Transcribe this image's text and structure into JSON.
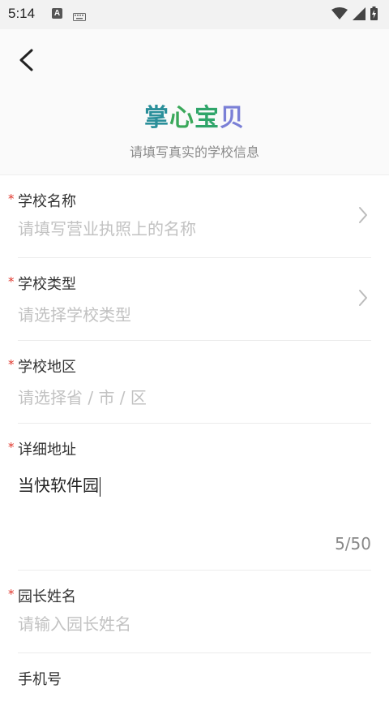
{
  "status_bar": {
    "time": "5:14",
    "notif_letter": "A"
  },
  "header": {
    "title_chars": [
      "掌",
      "心",
      "宝",
      "贝"
    ],
    "subtitle": "请填写真实的学校信息"
  },
  "colors": {
    "title_1": "#2a8f9a",
    "title_2": "#3aa85a",
    "title_3": "#2fa56a",
    "title_4": "#7a7fd6",
    "required": "#e0352b"
  },
  "form": {
    "school_name": {
      "label": "学校名称",
      "placeholder": "请填写营业执照上的名称"
    },
    "school_type": {
      "label": "学校类型",
      "placeholder": "请选择学校类型"
    },
    "school_region": {
      "label": "学校地区",
      "placeholder": "请选择省 / 市 / 区"
    },
    "address": {
      "label": "详细地址",
      "value": "当快软件园",
      "counter": "5/50"
    },
    "principal": {
      "label": "园长姓名",
      "placeholder": "请输入园长姓名"
    },
    "phone": {
      "label": "手机号"
    },
    "required_mark": "*"
  }
}
